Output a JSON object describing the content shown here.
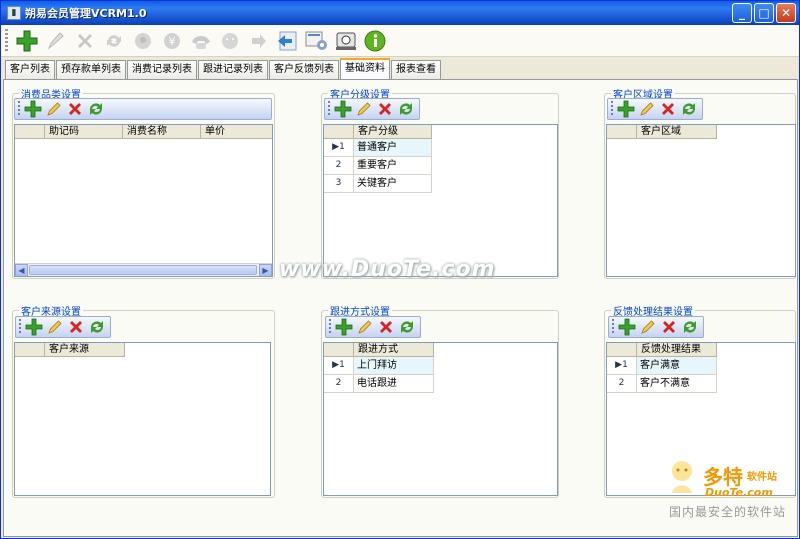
{
  "window": {
    "title": "朔易会员管理VCRM1.0",
    "min": "_",
    "max": "□",
    "close": "✕"
  },
  "toolbar": [
    "add-icon",
    "edit-icon",
    "delete-icon",
    "refresh-icon",
    "service-icon",
    "money-icon",
    "phone-icon",
    "smile-icon",
    "forward-icon",
    "import-icon",
    "settings-icon",
    "backup-icon",
    "info-icon"
  ],
  "tabs": [
    {
      "label": "客户列表",
      "active": false
    },
    {
      "label": "预存款单列表",
      "active": false
    },
    {
      "label": "消费记录列表",
      "active": false
    },
    {
      "label": "跟进记录列表",
      "active": false
    },
    {
      "label": "客户反馈列表",
      "active": false
    },
    {
      "label": "基础资料",
      "active": true
    },
    {
      "label": "报表查看",
      "active": false
    }
  ],
  "watermark": "www.DuoTe.com",
  "groups": {
    "consume": {
      "title": "消费品类设置",
      "columns": [
        "助记码",
        "消费名称",
        "单价"
      ],
      "rows": []
    },
    "level": {
      "title": "客户分级设置",
      "column": "客户分级",
      "rows": [
        {
          "no": "1",
          "text": "普通客户"
        },
        {
          "no": "2",
          "text": "重要客户"
        },
        {
          "no": "3",
          "text": "关键客户"
        }
      ]
    },
    "region": {
      "title": "客户区域设置",
      "column": "客户区域",
      "rows": []
    },
    "source": {
      "title": "客户来源设置",
      "column": "客户来源",
      "rows": []
    },
    "follow": {
      "title": "跟进方式设置",
      "column": "跟进方式",
      "rows": [
        {
          "no": "1",
          "text": "上门拜访"
        },
        {
          "no": "2",
          "text": "电话跟进"
        }
      ]
    },
    "feedback": {
      "title": "反馈处理结果设置",
      "column": "反馈处理结果",
      "rows": [
        {
          "no": "1",
          "text": "客户满意"
        },
        {
          "no": "2",
          "text": "客户不满意"
        }
      ]
    }
  },
  "logo": {
    "name": "多特",
    "tag": "软件站",
    "domain": "DuoTe.com",
    "slogan": "国内最安全的软件站"
  }
}
